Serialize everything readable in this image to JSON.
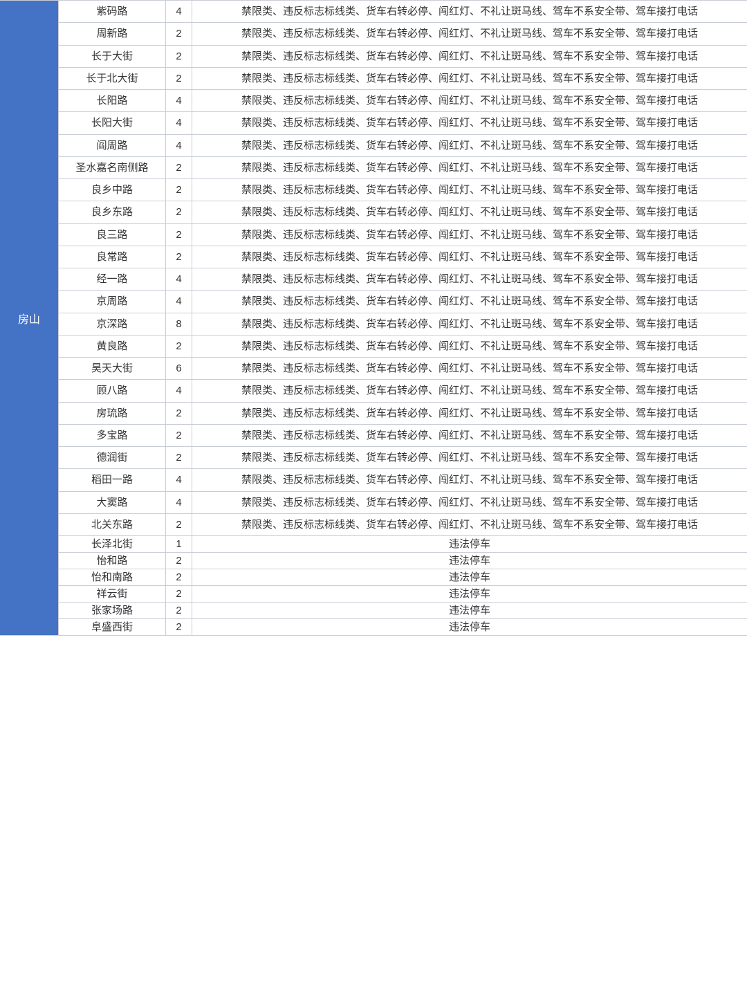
{
  "district": "房山",
  "violation_long": "禁限类、违反标志标线类、货车右转必停、闯红灯、不礼让斑马线、驾车不系安全带、驾车接打电话",
  "violation_short": "违法停车",
  "rows": [
    {
      "road": "紫码路",
      "count": 4,
      "desc_key": "violation_long"
    },
    {
      "road": "周新路",
      "count": 2,
      "desc_key": "violation_long"
    },
    {
      "road": "长于大街",
      "count": 2,
      "desc_key": "violation_long"
    },
    {
      "road": "长于北大街",
      "count": 2,
      "desc_key": "violation_long"
    },
    {
      "road": "长阳路",
      "count": 4,
      "desc_key": "violation_long"
    },
    {
      "road": "长阳大街",
      "count": 4,
      "desc_key": "violation_long"
    },
    {
      "road": "阎周路",
      "count": 4,
      "desc_key": "violation_long"
    },
    {
      "road": "圣水嘉名南侧路",
      "count": 2,
      "desc_key": "violation_long"
    },
    {
      "road": "良乡中路",
      "count": 2,
      "desc_key": "violation_long"
    },
    {
      "road": "良乡东路",
      "count": 2,
      "desc_key": "violation_long"
    },
    {
      "road": "良三路",
      "count": 2,
      "desc_key": "violation_long"
    },
    {
      "road": "良常路",
      "count": 2,
      "desc_key": "violation_long"
    },
    {
      "road": "经一路",
      "count": 4,
      "desc_key": "violation_long"
    },
    {
      "road": "京周路",
      "count": 4,
      "desc_key": "violation_long"
    },
    {
      "road": "京深路",
      "count": 8,
      "desc_key": "violation_long"
    },
    {
      "road": "黄良路",
      "count": 2,
      "desc_key": "violation_long"
    },
    {
      "road": "昊天大街",
      "count": 6,
      "desc_key": "violation_long"
    },
    {
      "road": "顾八路",
      "count": 4,
      "desc_key": "violation_long"
    },
    {
      "road": "房琉路",
      "count": 2,
      "desc_key": "violation_long"
    },
    {
      "road": "多宝路",
      "count": 2,
      "desc_key": "violation_long"
    },
    {
      "road": "德润街",
      "count": 2,
      "desc_key": "violation_long"
    },
    {
      "road": "稻田一路",
      "count": 4,
      "desc_key": "violation_long"
    },
    {
      "road": "大窦路",
      "count": 4,
      "desc_key": "violation_long"
    },
    {
      "road": "北关东路",
      "count": 2,
      "desc_key": "violation_long"
    },
    {
      "road": "长泽北街",
      "count": 1,
      "desc_key": "violation_short"
    },
    {
      "road": "怡和路",
      "count": 2,
      "desc_key": "violation_short"
    },
    {
      "road": "怡和南路",
      "count": 2,
      "desc_key": "violation_short"
    },
    {
      "road": "祥云街",
      "count": 2,
      "desc_key": "violation_short"
    },
    {
      "road": "张家场路",
      "count": 2,
      "desc_key": "violation_short"
    },
    {
      "road": "阜盛西街",
      "count": 2,
      "desc_key": "violation_short"
    }
  ]
}
